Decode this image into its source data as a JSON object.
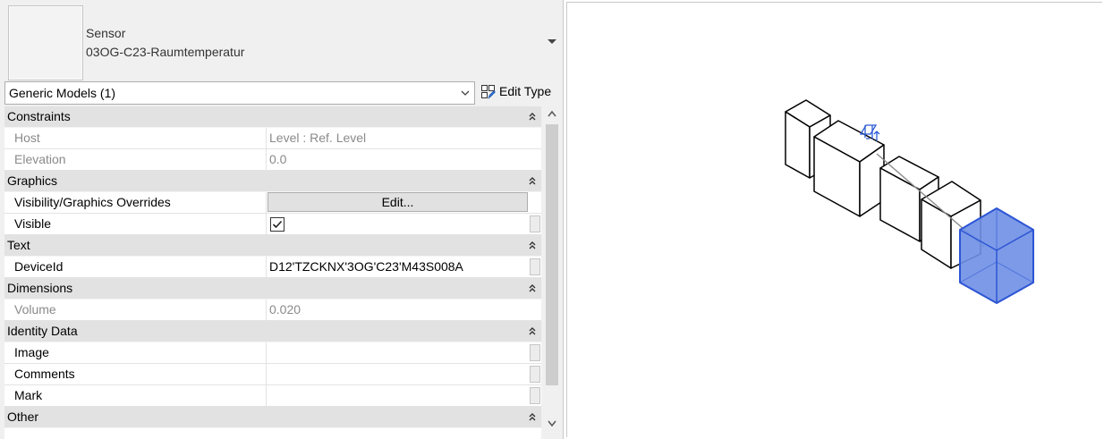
{
  "type_selector": {
    "family": "Sensor",
    "type": "03OG-C23-Raumtemperatur"
  },
  "category_selector": {
    "selected": "Generic Models (1)",
    "edit_type_label": "Edit Type"
  },
  "groups": {
    "constraints": "Constraints",
    "graphics": "Graphics",
    "text": "Text",
    "dimensions": "Dimensions",
    "identity_data": "Identity Data",
    "other": "Other"
  },
  "params": {
    "host": {
      "label": "Host",
      "value": "Level : Ref. Level"
    },
    "elevation": {
      "label": "Elevation",
      "value": "0.0"
    },
    "vg_overrides": {
      "label": "Visibility/Graphics Overrides",
      "button": "Edit..."
    },
    "visible": {
      "label": "Visible",
      "checked": true
    },
    "device_id": {
      "label": "DeviceId",
      "value": "D12'TZCKNX'3OG'C23'M43S008A"
    },
    "volume": {
      "label": "Volume",
      "value": "0.020"
    },
    "image": {
      "label": "Image",
      "value": ""
    },
    "comments": {
      "label": "Comments",
      "value": ""
    },
    "mark": {
      "label": "Mark",
      "value": ""
    }
  },
  "colors": {
    "selection": "#3f6fdc",
    "selection_fill": "#6f8fe6",
    "group_header": "#e2e2e2",
    "readonly_text": "#8a8a8a"
  },
  "icons": {
    "type_dropdown": "triangle-down-icon",
    "category_dropdown": "chevron-down-icon",
    "edit_type": "edit-type-icon",
    "group_collapse": "double-chevron-up-icon",
    "scroll_up": "chevron-up-icon",
    "scroll_down": "chevron-down-icon",
    "pin": "pin-icon"
  }
}
